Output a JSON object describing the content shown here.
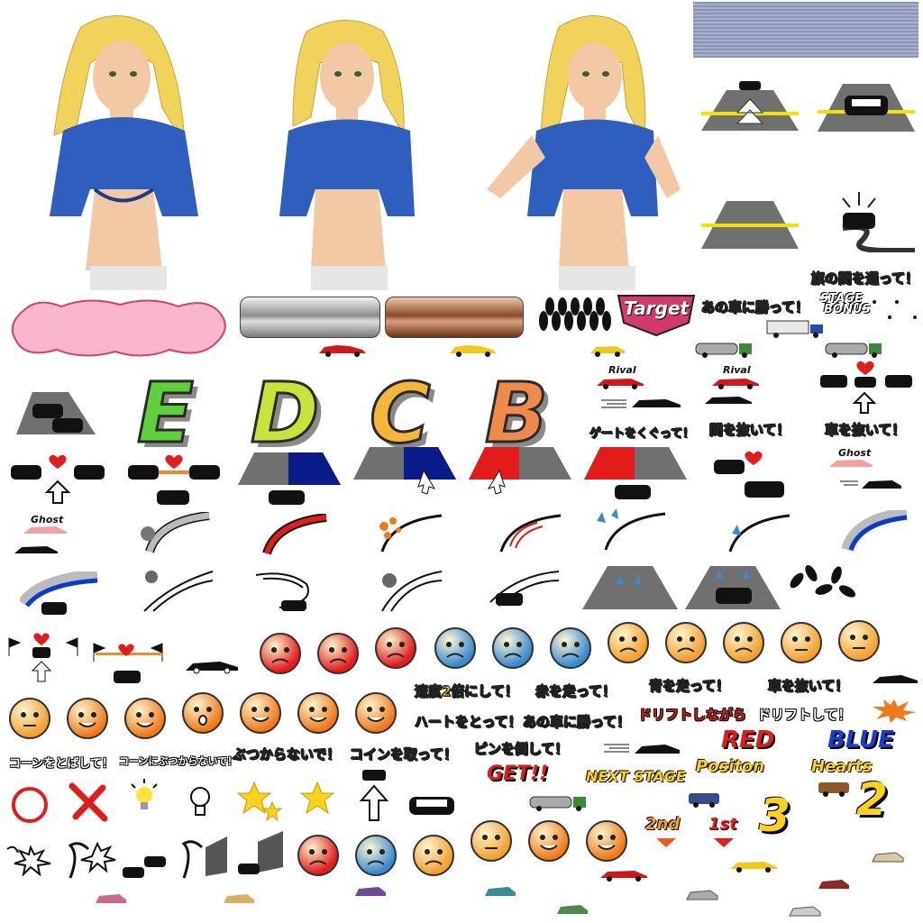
{
  "characters": [
    {
      "id": "girl-worried",
      "hair": "#f1d25a",
      "shirt": "#2e5fbf",
      "skin": "#f2c9a4"
    },
    {
      "id": "girl-neutral",
      "hair": "#f1d25a",
      "shirt": "#2e5fbf",
      "skin": "#f2c9a4"
    },
    {
      "id": "girl-cheerful",
      "hair": "#f1d25a",
      "shirt": "#2e5fbf",
      "skin": "#f2c9a4"
    }
  ],
  "labels": {
    "pass_flags": "旗の間を通って！",
    "beat_that_car": "あの車に勝って！",
    "target": "Target",
    "stage_bonus_1": "STAGE",
    "stage_bonus_2": "BONUS",
    "rival_1": "Rival",
    "rival_2": "Rival",
    "through_gate": "ゲートをくぐって！",
    "pass_between": "間を抜いて！",
    "pass_car": "車を抜いて！",
    "ghost_1": "Ghost",
    "ghost_2": "Ghost",
    "double_speed": "速度2倍にして！",
    "run_red": "赤を走って！",
    "run_blue": "青を走って！",
    "pass_car_2": "車を抜いて！",
    "take_hearts": "ハートをとって！",
    "beat_that_car_2": "あの車に勝って！",
    "while_drifting": "ドリフトしながら",
    "drift": "ドリフトして！",
    "knock_cones": "コーンをとばして！",
    "dont_hit_cones": "コーンにぶつからないで！",
    "dont_crash": "ぶつからないで！",
    "take_coins": "コインを取って！",
    "knock_pins": "ピンを倒して！",
    "red": "RED",
    "blue": "BLUE",
    "get": "GET!!",
    "next_stage": "NEXT STAGE",
    "positon": "Positon",
    "hearts": "Hearts",
    "second": "2nd",
    "first": "1st",
    "num_three": "3",
    "num_two": "2"
  },
  "grades": [
    {
      "letter": "E",
      "color": "#5fcf3a"
    },
    {
      "letter": "D",
      "color": "#c8e43a"
    },
    {
      "letter": "C",
      "color": "#f5b63a"
    },
    {
      "letter": "B",
      "color": "#f08a4a"
    }
  ],
  "colors": {
    "road": "#707070",
    "lane": "#f5e000",
    "red": "#e21b1b",
    "blue": "#0a1a8a",
    "pink_cloud": "#f9b6cc",
    "silver": "#c8c8c8",
    "copper": "#b0704a",
    "banner": "#8a94b8"
  },
  "icons": [
    "car-icon",
    "heart-icon",
    "arrow-icon",
    "flag-icon",
    "bowling-pins-icon",
    "cone-icon",
    "star-icon",
    "lightbulb-icon",
    "circle-icon",
    "cross-icon"
  ]
}
